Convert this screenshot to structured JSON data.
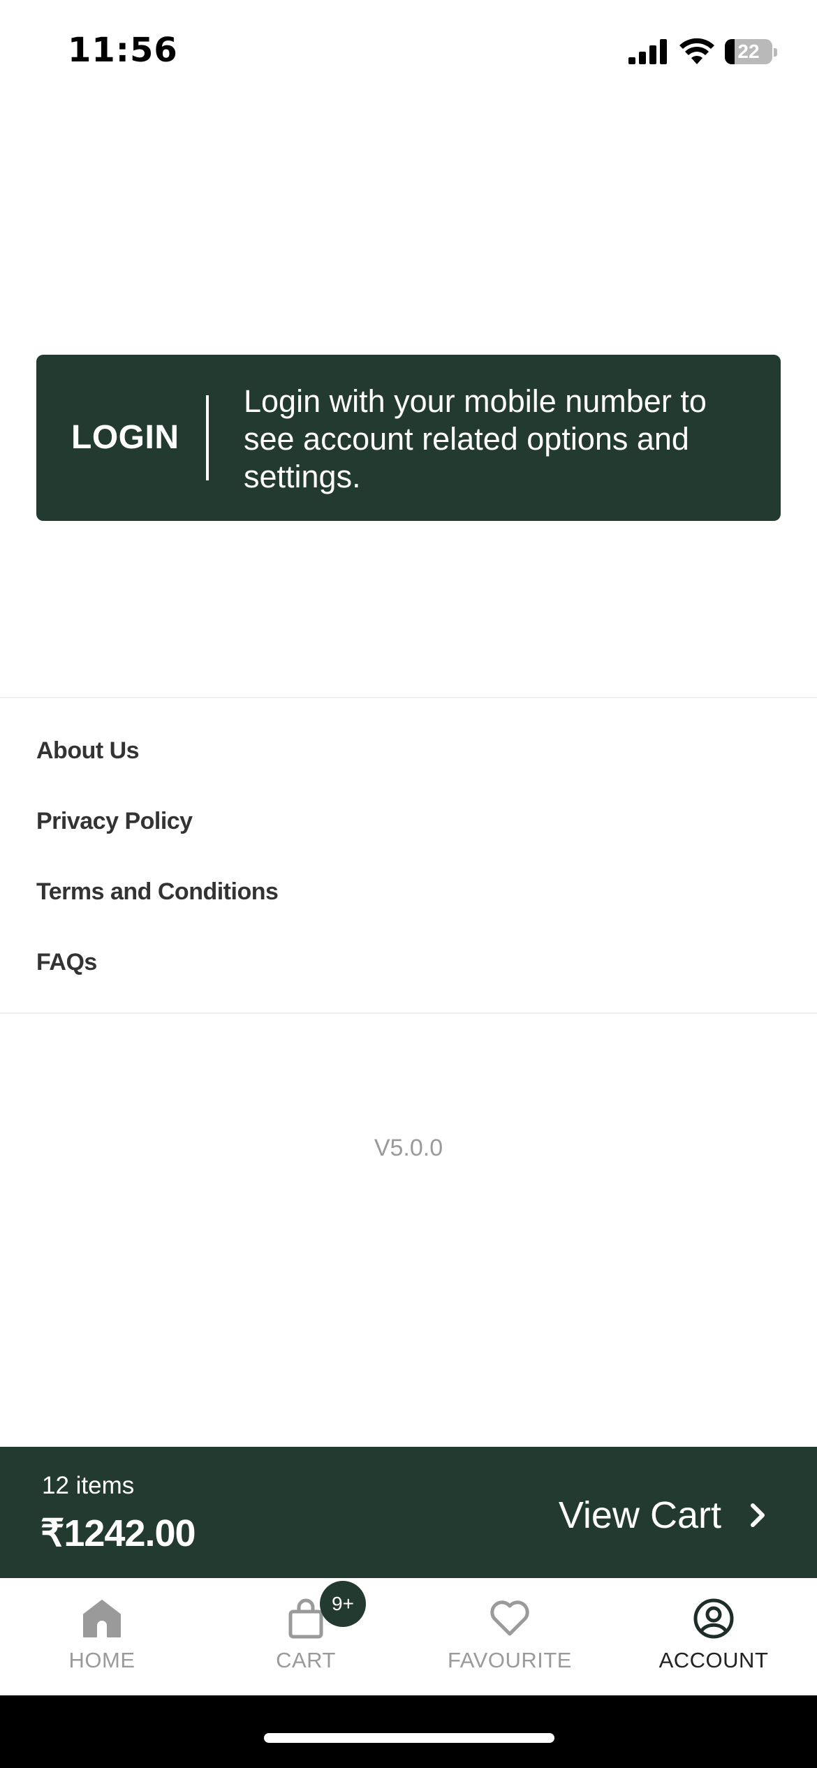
{
  "status_bar": {
    "time": "11:56",
    "battery_level": "22",
    "icons": [
      "signal-icon",
      "wifi-icon",
      "battery-icon"
    ]
  },
  "login_card": {
    "label": "LOGIN",
    "message": "Login with your mobile number to see account related options and settings.",
    "background_color": "#233a30"
  },
  "menu": {
    "items": [
      {
        "label": "About Us"
      },
      {
        "label": "Privacy Policy"
      },
      {
        "label": "Terms and Conditions"
      },
      {
        "label": "FAQs"
      }
    ]
  },
  "version": "V5.0.0",
  "cart_bar": {
    "items_count": "12 items",
    "total": "₹1242.00",
    "action_label": "View Cart",
    "icon": "chevron-right-icon"
  },
  "tab_bar": {
    "tabs": [
      {
        "label": "HOME",
        "icon": "home-icon",
        "active": false
      },
      {
        "label": "CART",
        "icon": "cart-icon",
        "active": false,
        "badge": "9+"
      },
      {
        "label": "FAVOURITE",
        "icon": "heart-icon",
        "active": false
      },
      {
        "label": "ACCOUNT",
        "icon": "account-icon",
        "active": true
      }
    ]
  }
}
